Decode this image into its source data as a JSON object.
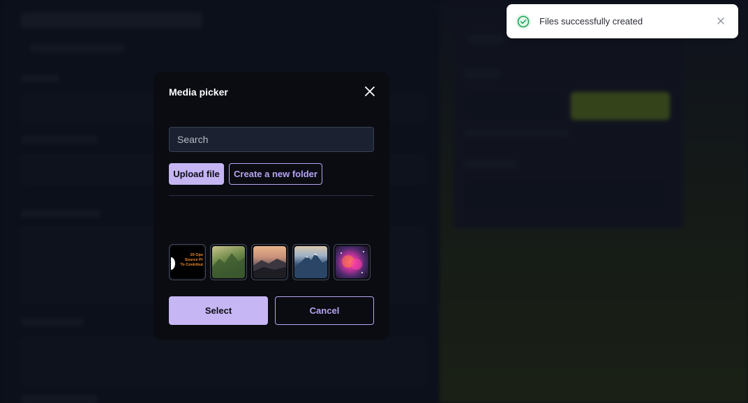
{
  "modal": {
    "title": "Media picker",
    "search_placeholder": "Search",
    "upload_label": "Upload file",
    "create_folder_label": "Create a new folder",
    "select_label": "Select",
    "cancel_label": "Cancel",
    "thumbnails": [
      {
        "name": "thumbnail-open-source-banner",
        "text": "20 Ope\n Source Pr\nTo Contribut"
      },
      {
        "name": "thumbnail-green-mountains"
      },
      {
        "name": "thumbnail-sunset-mountains"
      },
      {
        "name": "thumbnail-snowy-peaks"
      },
      {
        "name": "thumbnail-nebula"
      }
    ]
  },
  "toast": {
    "message": "Files successfully created",
    "accent_color": "#22a35a"
  },
  "colors": {
    "primary": "#c5b5f3",
    "primary_outline": "#b7a4f1",
    "modal_bg": "#0a0c12"
  }
}
